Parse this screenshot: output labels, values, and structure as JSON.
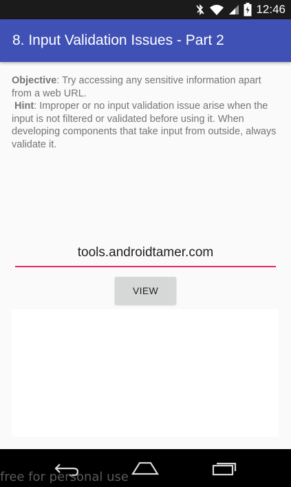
{
  "status_bar": {
    "time": "12:46",
    "icons": [
      "bluetooth-off-icon",
      "wifi-icon",
      "signal-icon",
      "battery-icon"
    ]
  },
  "app_bar": {
    "title": "8. Input Validation Issues - Part 2",
    "color": "#3f51b5"
  },
  "content": {
    "objective_label": "Objective",
    "objective_text": ": Try accessing any sensitive information apart from a web URL.",
    "hint_label": "Hint",
    "hint_text": ": Improper or no input validation issue arise when the input is not filtered or validated before using it. When developing components that take input from outside, always validate it."
  },
  "url_input": {
    "value": "tools.androidtamer.com",
    "underline_color": "#e91e63"
  },
  "view_button": {
    "label": "VIEW"
  },
  "nav_bar": {
    "icons": [
      "back-icon",
      "home-icon",
      "recents-icon"
    ]
  },
  "watermark": {
    "text": "free for personal use"
  }
}
